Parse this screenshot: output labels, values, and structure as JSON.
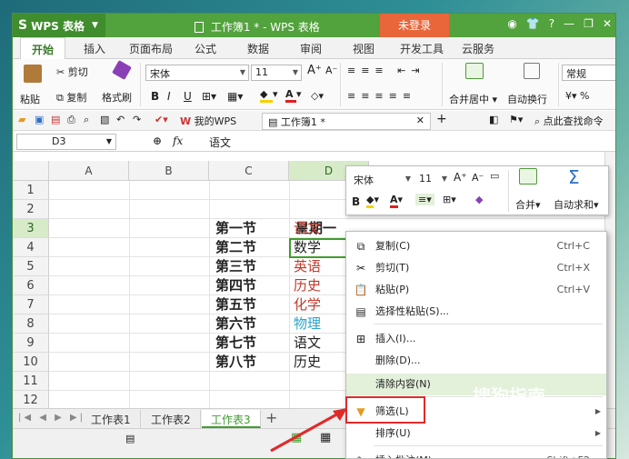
{
  "titlebar": {
    "app_name": "WPS 表格",
    "title": "工作簿1 * - WPS 表格",
    "login": "未登录",
    "icons": [
      "skin-icon",
      "shirt-icon",
      "help-icon",
      "minimize-icon",
      "restore-icon",
      "close-icon"
    ]
  },
  "tabs": [
    "开始",
    "插入",
    "页面布局",
    "公式",
    "数据",
    "审阅",
    "视图",
    "开发工具",
    "云服务"
  ],
  "ribbon": {
    "paste": "粘贴",
    "cut": "剪切",
    "copy": "复制",
    "format_painter": "格式刷",
    "font_name": "宋体",
    "font_size": "11",
    "merge_center": "合并居中",
    "wrap_text": "自动换行",
    "number_format": "常规",
    "bold": "B",
    "italic": "I",
    "underline": "U",
    "grow_font": "A⁺",
    "shrink_font": "A⁻"
  },
  "quickbar": {
    "doc_tabs": [
      "我的WPS",
      "工作簿1 *"
    ],
    "search": "点此查找命令"
  },
  "formula": {
    "namebox": "D3",
    "fx": "fx",
    "value": "语文"
  },
  "grid": {
    "columns": [
      "A",
      "B",
      "C",
      "D"
    ],
    "rows": [
      "1",
      "2",
      "3",
      "4",
      "5",
      "6",
      "7",
      "8",
      "9",
      "10",
      "11",
      "12"
    ],
    "header_d2": "星期一",
    "col_c": [
      "第一节",
      "第二节",
      "第三节",
      "第四节",
      "第五节",
      "第六节",
      "第七节",
      "第八节"
    ],
    "col_d": [
      "语文",
      "数学",
      "英语",
      "历史",
      "化学",
      "物理",
      "语文",
      "历史"
    ],
    "col_d_colors": [
      "#c0392b",
      "#222222",
      "#c0392b",
      "#c0392b",
      "#c0392b",
      "#2aa3c9",
      "#222222",
      "#222222"
    ]
  },
  "sheets": [
    "工作表1",
    "工作表2",
    "工作表3"
  ],
  "mini_toolbar": {
    "font_name": "宋体",
    "font_size": "11",
    "merge": "合并",
    "autosum": "自动求和"
  },
  "context_menu": [
    {
      "label": "复制(C)",
      "shortcut": "Ctrl+C",
      "icon": "copy-icon"
    },
    {
      "label": "剪切(T)",
      "shortcut": "Ctrl+X",
      "icon": "scissors-icon"
    },
    {
      "label": "粘贴(P)",
      "shortcut": "Ctrl+V",
      "icon": "paste-icon"
    },
    {
      "label": "选择性粘贴(S)...",
      "shortcut": "",
      "icon": "paste-special-icon"
    },
    {
      "label": "插入(I)...",
      "shortcut": "",
      "icon": "insert-icon"
    },
    {
      "label": "删除(D)...",
      "shortcut": "",
      "icon": ""
    },
    {
      "label": "清除内容(N)",
      "shortcut": "",
      "icon": ""
    },
    {
      "label": "筛选(L)",
      "shortcut": "",
      "icon": "filter-icon"
    },
    {
      "label": "排序(U)",
      "shortcut": "",
      "icon": ""
    },
    {
      "label": "插入批注(M)...",
      "shortcut": "Shift+F2",
      "icon": "comment-icon"
    }
  ],
  "watermark": {
    "text": "搜狗指南",
    "sub": "zhinan.sogou.com"
  },
  "colors": {
    "wps_green": "#52a23d",
    "login_orange": "#e9663a",
    "highlight_red": "#e02a2a"
  }
}
